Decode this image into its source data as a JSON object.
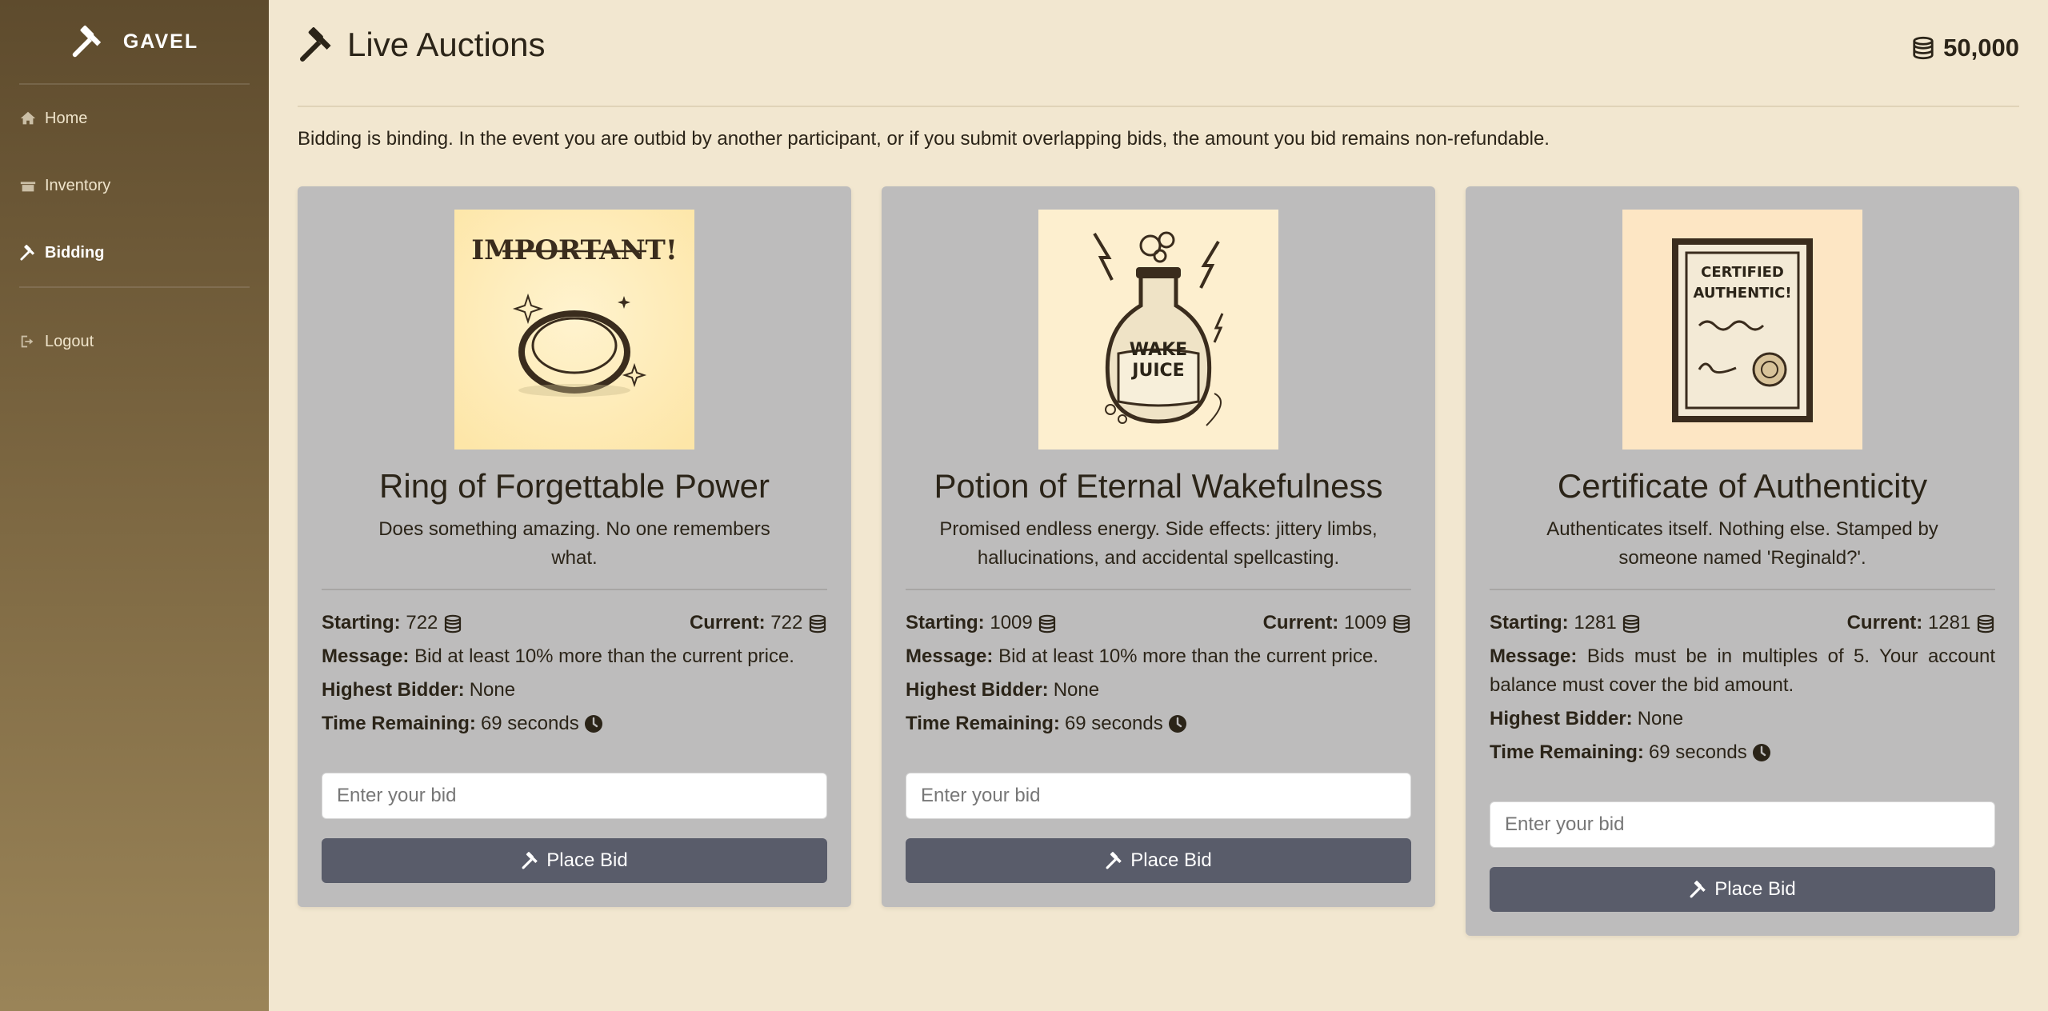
{
  "sidebar": {
    "brand": "GAVEL",
    "items": [
      {
        "label": "Home",
        "icon": "home-icon"
      },
      {
        "label": "Inventory",
        "icon": "inventory-icon"
      },
      {
        "label": "Bidding",
        "icon": "gavel-icon",
        "active": true
      },
      {
        "label": "Logout",
        "icon": "logout-icon"
      }
    ]
  },
  "header": {
    "title": "Live Auctions",
    "balance": "50,000"
  },
  "notice": "Bidding is binding. In the event you are outbid by another participant, or if you submit overlapping bids, the amount you bid remains non-refundable.",
  "labels": {
    "starting": "Starting:",
    "current": "Current:",
    "message": "Message:",
    "highest_bidder": "Highest Bidder:",
    "time_remaining": "Time Remaining:",
    "place_bid": "Place Bid",
    "bid_placeholder": "Enter your bid"
  },
  "cards": [
    {
      "image_text": "IMPORTANT!",
      "title": "Ring of Forgettable Power",
      "description": "Does something amazing. No one remembers what.",
      "starting": "722",
      "current": "722",
      "message": "Bid at least 10% more than the current price.",
      "highest_bidder": "None",
      "time_remaining": "69 seconds"
    },
    {
      "image_text": "WAKE JUICE",
      "title": "Potion of Eternal Wakefulness",
      "description": "Promised endless energy. Side effects: jittery limbs, hallucinations, and accidental spellcasting.",
      "starting": "1009",
      "current": "1009",
      "message": "Bid at least 10% more than the current price.",
      "highest_bidder": "None",
      "time_remaining": "69 seconds"
    },
    {
      "image_text": "CERTIFIED AUTHENTIC!",
      "title": "Certificate of Authenticity",
      "description": "Authenticates itself. Nothing else. Stamped by someone named 'Reginald?'.",
      "starting": "1281",
      "current": "1281",
      "message": "Bids must be in multiples of 5. Your account balance must cover the bid amount.",
      "highest_bidder": "None",
      "time_remaining": "69 seconds"
    }
  ]
}
